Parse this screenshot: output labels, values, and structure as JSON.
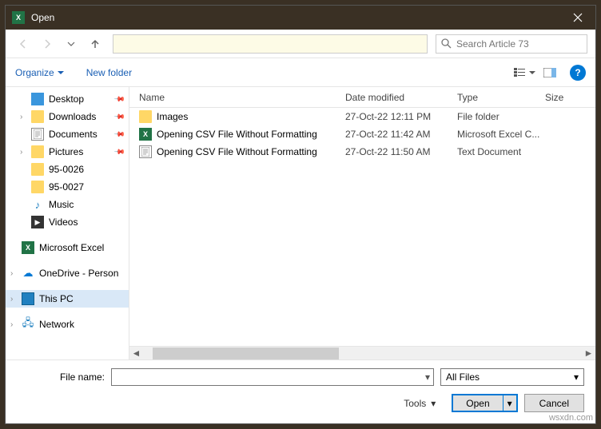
{
  "titlebar": {
    "title": "Open"
  },
  "search": {
    "placeholder": "Search Article 73"
  },
  "toolbar": {
    "organize": "Organize",
    "newfolder": "New folder"
  },
  "columns": {
    "name": "Name",
    "date": "Date modified",
    "type": "Type",
    "size": "Size"
  },
  "sidebar": {
    "items": [
      {
        "label": "Desktop",
        "icon": "desktop",
        "lvl": 2,
        "pin": true
      },
      {
        "label": "Downloads",
        "icon": "folder",
        "lvl": 2,
        "pin": true,
        "exp": ">"
      },
      {
        "label": "Documents",
        "icon": "doc",
        "lvl": 2,
        "pin": true
      },
      {
        "label": "Pictures",
        "icon": "folder",
        "lvl": 2,
        "pin": true,
        "exp": ">"
      },
      {
        "label": "95-0026",
        "icon": "folder",
        "lvl": 2
      },
      {
        "label": "95-0027",
        "icon": "folder",
        "lvl": 2
      },
      {
        "label": "Music",
        "icon": "music",
        "lvl": 2
      },
      {
        "label": "Videos",
        "icon": "video",
        "lvl": 2
      },
      {
        "gap": true
      },
      {
        "label": "Microsoft Excel",
        "icon": "excel",
        "lvl": 1
      },
      {
        "gap": true
      },
      {
        "label": "OneDrive - Person",
        "icon": "cloud",
        "lvl": 1,
        "exp": ">"
      },
      {
        "gap": true
      },
      {
        "label": "This PC",
        "icon": "monitor",
        "lvl": 1,
        "exp": ">",
        "sel": true
      },
      {
        "gap": true
      },
      {
        "label": "Network",
        "icon": "network",
        "lvl": 1,
        "exp": ">"
      }
    ]
  },
  "files": [
    {
      "name": "Images",
      "date": "27-Oct-22 12:11 PM",
      "type": "File folder",
      "icon": "folder"
    },
    {
      "name": "Opening CSV File Without Formatting",
      "date": "27-Oct-22 11:42 AM",
      "type": "Microsoft Excel C...",
      "icon": "excel"
    },
    {
      "name": "Opening CSV File Without Formatting",
      "date": "27-Oct-22 11:50 AM",
      "type": "Text Document",
      "icon": "doc"
    }
  ],
  "footer": {
    "filename_label": "File name:",
    "filter": "All Files",
    "tools": "Tools",
    "open": "Open",
    "cancel": "Cancel"
  },
  "watermark": "wsxdn.com"
}
